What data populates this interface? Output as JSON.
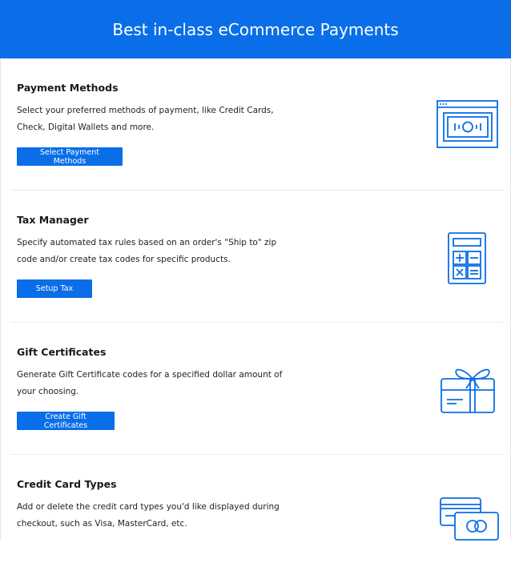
{
  "header": {
    "title": "Best in-class eCommerce Payments",
    "background_color": "#0a6ee8"
  },
  "sections": [
    {
      "title": "Payment Methods",
      "description": "Select your preferred methods of payment, like Credit Cards, Check, Digital Wallets and more.",
      "button_label": "Select Payment Methods",
      "icon": "payment-window-icon"
    },
    {
      "title": "Tax Manager",
      "description": "Specify automated tax rules based on an order's \"Ship to\" zip code and/or create tax codes for specific products.",
      "button_label": "Setup Tax",
      "icon": "calculator-icon"
    },
    {
      "title": "Gift Certificates",
      "description": "Generate Gift Certificate codes for a specified dollar amount of your choosing.",
      "button_label": "Create Gift Certificates",
      "icon": "gift-card-icon"
    },
    {
      "title": "Credit Card Types",
      "description": "Add or delete the credit card types you'd like displayed during checkout, such as Visa, MasterCard, etc.",
      "button_label": "",
      "icon": "credit-cards-icon"
    }
  ],
  "colors": {
    "accent": "#0a6ee8",
    "icon_stroke": "#0a6ee8"
  }
}
